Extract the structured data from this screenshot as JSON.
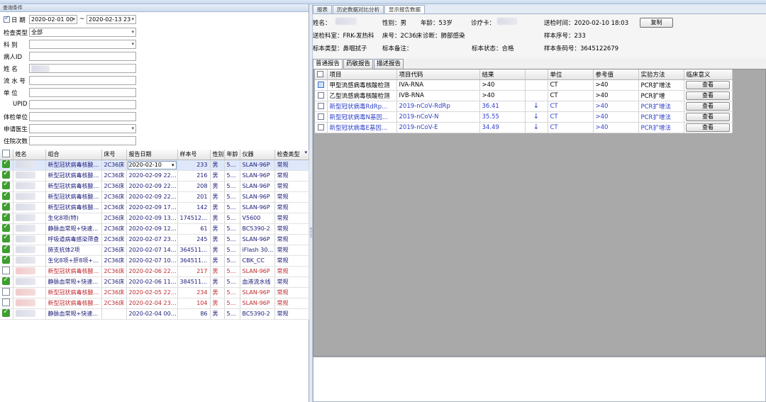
{
  "left": {
    "group_title": "查询条件",
    "query": {
      "date_label": "日 期",
      "date_from": "2020-02-01 00",
      "date_sep": "~",
      "date_to": "2020-02-13 23",
      "exam_type_label": "检查类型",
      "exam_type_value": "全部",
      "dept_label": "科 别",
      "patient_id_label": "病人ID",
      "name_label": "姓 名",
      "serial_label": "流 水 号",
      "unit_label": "单 位",
      "upid_label": "UPID",
      "checkup_unit_label": "体检单位",
      "doctor_label": "申请医生",
      "visits_label": "住院次数"
    },
    "grid": {
      "headers": [
        "",
        "姓名",
        "组合",
        "床号",
        "报告日期",
        "样本号",
        "性别",
        "年龄",
        "仪器",
        "检查类型"
      ],
      "rows": [
        {
          "checked": true,
          "combo": "新型冠状病毒核酸检...",
          "bed": "2C36床",
          "date": "2020-02-10",
          "sample": "233",
          "sex": "男",
          "age": "53岁",
          "instrument": "SLAN-96P",
          "type": "常规",
          "red": false,
          "selected": true
        },
        {
          "checked": true,
          "combo": "新型冠状病毒核酸检...",
          "bed": "2C36床",
          "date": "2020-02-09 22:41",
          "sample": "216",
          "sex": "男",
          "age": "53岁",
          "instrument": "SLAN-96P",
          "type": "常规",
          "red": false,
          "selected": false
        },
        {
          "checked": true,
          "combo": "新型冠状病毒核酸检...",
          "bed": "2C36床",
          "date": "2020-02-09 22:41",
          "sample": "208",
          "sex": "男",
          "age": "53岁",
          "instrument": "SLAN-96P",
          "type": "常规",
          "red": false,
          "selected": false
        },
        {
          "checked": true,
          "combo": "新型冠状病毒核酸检...",
          "bed": "2C36床",
          "date": "2020-02-09 22:41",
          "sample": "201",
          "sex": "男",
          "age": "53岁",
          "instrument": "SLAN-96P",
          "type": "常规",
          "red": false,
          "selected": false
        },
        {
          "checked": true,
          "combo": "新型冠状病毒核酸检...",
          "bed": "2C36床",
          "date": "2020-02-09 17:20",
          "sample": "142",
          "sex": "男",
          "age": "53岁",
          "instrument": "SLAN-96P",
          "type": "常规",
          "red": false,
          "selected": false
        },
        {
          "checked": true,
          "combo": "生化8项(特)",
          "bed": "2C36床",
          "date": "2020-02-09 13:03",
          "sample": "1745121...",
          "sex": "男",
          "age": "53岁",
          "instrument": "V5600",
          "type": "常规",
          "red": false,
          "selected": false
        },
        {
          "checked": true,
          "combo": "静脉血常规+快速CRP",
          "bed": "2C36床",
          "date": "2020-02-09 12:24",
          "sample": "61",
          "sex": "男",
          "age": "53岁",
          "instrument": "BC5390-2",
          "type": "常规",
          "red": false,
          "selected": false
        },
        {
          "checked": true,
          "combo": "呼吸道病毒感染筛查",
          "bed": "2C36床",
          "date": "2020-02-07 23:18",
          "sample": "245",
          "sex": "男",
          "age": "53岁",
          "instrument": "SLAN-96P",
          "type": "常规",
          "red": false,
          "selected": false
        },
        {
          "checked": true,
          "combo": "肺支抗体2项",
          "bed": "2C36床",
          "date": "2020-02-07 14:58",
          "sample": "3645118...",
          "sex": "男",
          "age": "53岁",
          "instrument": "iFlash 3000",
          "type": "常规",
          "red": false,
          "selected": false
        },
        {
          "checked": true,
          "combo": "生化8项+肝8项+心5...",
          "bed": "2C36床",
          "date": "2020-02-07 10:50",
          "sample": "3645118...",
          "sex": "男",
          "age": "53岁",
          "instrument": "CBK_CC",
          "type": "常规",
          "red": false,
          "selected": false
        },
        {
          "checked": false,
          "combo": "新型冠状病毒核酸检...",
          "bed": "2C36床",
          "date": "2020-02-06 22:28",
          "sample": "217",
          "sex": "男",
          "age": "53岁",
          "instrument": "SLAN-96P",
          "type": "常规",
          "red": true,
          "selected": false
        },
        {
          "checked": true,
          "combo": "静脉血常规+快速CRP",
          "bed": "2C36床",
          "date": "2020-02-06 11:53",
          "sample": "3845117...",
          "sex": "男",
          "age": "53岁",
          "instrument": "血液流水线",
          "type": "常规",
          "red": false,
          "selected": false
        },
        {
          "checked": false,
          "combo": "新型冠状病毒核酸检...",
          "bed": "2C36床",
          "date": "2020-02-05 22:09",
          "sample": "234",
          "sex": "男",
          "age": "53岁",
          "instrument": "SLAN-96P",
          "type": "常规",
          "red": true,
          "selected": false
        },
        {
          "checked": false,
          "combo": "新型冠状病毒核酸检...",
          "bed": "2C36床",
          "date": "2020-02-04 23:48",
          "sample": "104",
          "sex": "男",
          "age": "53岁",
          "instrument": "SLAN-96P",
          "type": "常规",
          "red": true,
          "selected": false
        },
        {
          "checked": true,
          "combo": "静脉血常规+快速CRP",
          "bed": "",
          "date": "2020-02-04 00:07",
          "sample": "86",
          "sex": "男",
          "age": "53岁",
          "instrument": "BC5390-2",
          "type": "常规",
          "red": false,
          "selected": false
        }
      ]
    }
  },
  "right": {
    "tabs": [
      "报表",
      "历史数据对比分析",
      "显示报告数据"
    ],
    "info": {
      "name_label": "姓名：",
      "sex": "性别：男",
      "age": "年龄：53岁",
      "card_label": "诊疗卡：",
      "send_time": "送检时间：2020-02-10 18:03",
      "copy_button": "复制",
      "dept": "送检科室：FRK-发热科",
      "bed": "床号：2C36床",
      "diagnosis": "诊断：肺部感染",
      "sample_no": "样本序号：233",
      "sample_type": "标本类型：鼻咽拭子",
      "sample_note": "标本备注：",
      "sample_status": "标本状态：合格",
      "barcode": "样本条码号：3645122679"
    },
    "subtabs": [
      "普通报告",
      "药敏报告",
      "描述报告"
    ],
    "grid": {
      "headers": [
        "",
        "项目",
        "项目代码",
        "结果",
        "",
        "单位",
        "参考值",
        "实验方法",
        "临床意义"
      ],
      "rows": [
        {
          "item": "甲型流感病毒核酸检测",
          "code": "IVA-RNA",
          "result": ">40",
          "flag": "",
          "unit": "CT",
          "ref": ">40",
          "method": "PCR扩增法",
          "action": "查看",
          "blue": false
        },
        {
          "item": "乙型流感病毒核酸检测",
          "code": "IVB-RNA",
          "result": ">40",
          "flag": "",
          "unit": "CT",
          "ref": ">40",
          "method": "PCR扩增",
          "action": "查看",
          "blue": false
        },
        {
          "item": "新型冠状病毒RdRp...",
          "code": "2019-nCoV-RdRp",
          "result": "36.41",
          "flag": "↓",
          "unit": "CT",
          "ref": ">40",
          "method": "PCR扩增法",
          "action": "查看",
          "blue": true
        },
        {
          "item": "新型冠状病毒N基因...",
          "code": "2019-nCoV-N",
          "result": "35.55",
          "flag": "↓",
          "unit": "CT",
          "ref": ">40",
          "method": "PCR扩增法",
          "action": "查看",
          "blue": true
        },
        {
          "item": "新型冠状病毒E基因...",
          "code": "2019-nCoV-E",
          "result": "34.49",
          "flag": "↓",
          "unit": "CT",
          "ref": ">40",
          "method": "PCR扩增法",
          "action": "查看",
          "blue": true
        }
      ]
    }
  }
}
